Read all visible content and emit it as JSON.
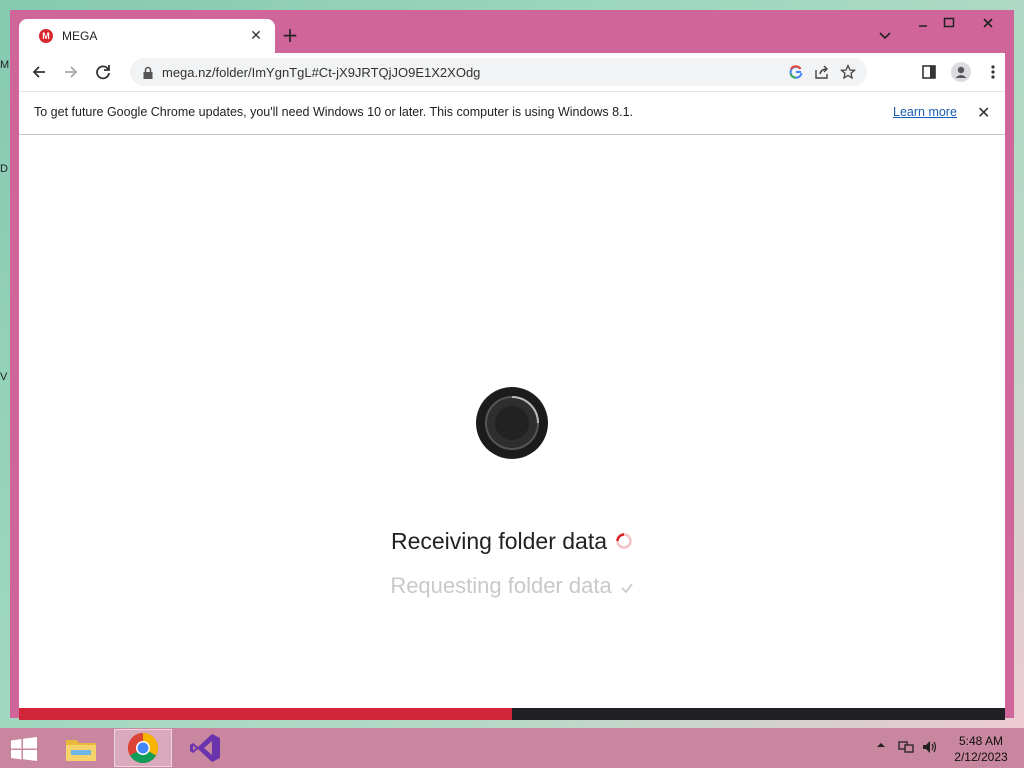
{
  "desktop": {
    "edge_letters": [
      "M",
      "D",
      "V"
    ]
  },
  "browser": {
    "tab": {
      "title": "MEGA",
      "favicon_label": "M"
    },
    "url": "mega.nz/folder/ImYgnTgL#Ct-jX9JRTQjJO9E1X2XOdg",
    "infobar": {
      "message": "To get future Google Chrome updates, you'll need Windows 10 or later. This computer is using Windows 8.1.",
      "link": "Learn more"
    }
  },
  "page": {
    "status_main": "Receiving folder data",
    "status_sub": "Requesting folder data",
    "progress_fraction": 0.5,
    "colors": {
      "progress": "#d3253a",
      "track": "#1f1f24",
      "accent": "#d9272e"
    }
  },
  "taskbar": {
    "time": "5:48 AM",
    "date": "2/12/2023"
  }
}
